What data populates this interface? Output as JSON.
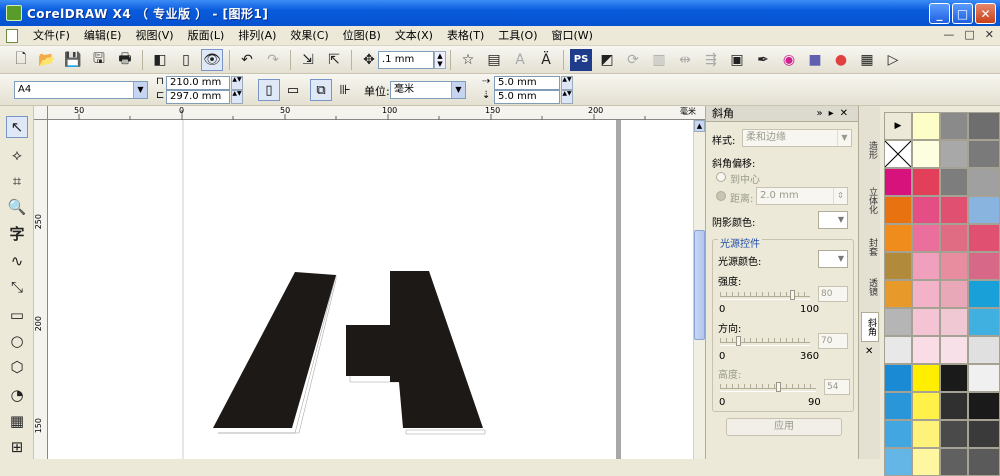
{
  "window": {
    "title": "CorelDRAW X4 （ 专业版 ） - [图形1]"
  },
  "menu": {
    "items": [
      "文件(F)",
      "编辑(E)",
      "视图(V)",
      "版面(L)",
      "排列(A)",
      "效果(C)",
      "位图(B)",
      "文本(X)",
      "表格(T)",
      "工具(O)",
      "窗口(W)"
    ],
    "mdi": [
      "—",
      "□",
      "✕"
    ]
  },
  "toolbar": {
    "nudge": ".1 mm"
  },
  "property_bar": {
    "page_size": "A4",
    "width": "210.0 mm",
    "height": "297.0 mm",
    "units_label": "单位:",
    "units_value": "毫米",
    "dup_x": "5.0 mm",
    "dup_y": "5.0 mm"
  },
  "rulers": {
    "h_ticks": [
      "50",
      "0",
      "50",
      "100",
      "150",
      "200"
    ],
    "h_unit": "毫米",
    "v_ticks": [
      "250",
      "200",
      "150"
    ]
  },
  "docker": {
    "title": "斜角",
    "style_label": "样式:",
    "style_value": "柔和边缘",
    "offset_label": "斜角偏移:",
    "to_center": "到中心",
    "distance_label": "距离:",
    "distance_value": "2.0 mm",
    "shadow_color_label": "阴影颜色:",
    "light_group": "光源控件",
    "light_color_label": "光源颜色:",
    "intensity_label": "强度:",
    "intensity_min": "0",
    "intensity_max": "100",
    "intensity_value": "80",
    "direction_label": "方向:",
    "direction_min": "0",
    "direction_max": "360",
    "direction_value": "70",
    "altitude_label": "高度:",
    "altitude_min": "0",
    "altitude_max": "90",
    "altitude_value": "54",
    "apply": "应用"
  },
  "docker_tabs": [
    "造形",
    "立体化",
    "封套",
    "透镜",
    "斜角"
  ],
  "palette": {
    "colors": [
      [
        "#c9e6f8",
        "#fdfdc8",
        "#8a8a8a"
      ],
      [
        "#d9eef9",
        "#fdfde0",
        "#a8a8a8"
      ],
      [
        "#d8127c",
        "#e2405a",
        "#7d7d7d"
      ],
      [
        "#e8720f",
        "#e44e85",
        "#e05070"
      ],
      [
        "#f08c1c",
        "#ea6f9c",
        "#e06c84"
      ],
      [
        "#b28a3c",
        "#f0a0bc",
        "#e88ca0"
      ],
      [
        "#e79a2a",
        "#f2b3c8",
        "#e8a8b8"
      ],
      [
        "#b5b5b5",
        "#f4c4d4",
        "#f0c8d4"
      ],
      [
        "#e8e8e8",
        "#fadce6",
        "#f8e0e8"
      ],
      [
        "#1a8ad4",
        "#ffee00",
        "#1a1a1a"
      ],
      [
        "#2896d8",
        "#fff04a",
        "#303030"
      ],
      [
        "#42a6e0",
        "#fff27a",
        "#4a4a4a"
      ],
      [
        "#64b6e6",
        "#fff6a0",
        "#606060"
      ]
    ],
    "edge_colors": [
      "#6e6e6e",
      "#7a7a7a",
      "#a0a0a0",
      "#8ab4e0",
      "#e05070",
      "#d86888",
      "#1aa0d8",
      "#40b0e0",
      "#e0e0e0",
      "#f0f0f0",
      "#1a1a1a",
      "#3a3a3a",
      "#5a5a5a"
    ]
  }
}
